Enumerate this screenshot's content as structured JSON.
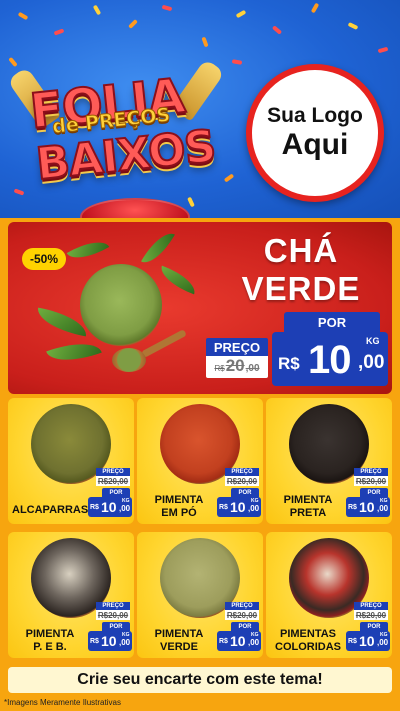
{
  "header": {
    "title_line1": "FOLIA",
    "title_line2": "de PREÇOS",
    "title_line3": "BAIXOS",
    "logo_line1": "Sua Logo",
    "logo_line2": "Aqui"
  },
  "featured": {
    "discount": "-50%",
    "title_line1": "CHÁ",
    "title_line2": "VERDE",
    "old_label": "PREÇO",
    "old_currency": "R$",
    "old_amount": "20",
    "old_cents": ",00",
    "new_label": "POR",
    "new_currency": "R$",
    "new_amount": "10",
    "new_cents": ",00",
    "unit": "KG"
  },
  "products": [
    {
      "name": "ALCAPARRAS",
      "old_label": "PREÇO",
      "old_price": "R$20,00",
      "new_label": "POR",
      "currency": "R$",
      "amount": "10",
      "cents": ",00",
      "unit": "KG"
    },
    {
      "name": "PIMENTA\nEM PÓ",
      "old_label": "PREÇO",
      "old_price": "R$20,00",
      "new_label": "POR",
      "currency": "R$",
      "amount": "10",
      "cents": ",00",
      "unit": "KG"
    },
    {
      "name": "PIMENTA\nPRETA",
      "old_label": "PREÇO",
      "old_price": "R$20,00",
      "new_label": "POR",
      "currency": "R$",
      "amount": "10",
      "cents": ",00",
      "unit": "KG"
    },
    {
      "name": "PIMENTA\nP. E B.",
      "old_label": "PREÇO",
      "old_price": "R$20,00",
      "new_label": "POR",
      "currency": "R$",
      "amount": "10",
      "cents": ",00",
      "unit": "KG"
    },
    {
      "name": "PIMENTA\nVERDE",
      "old_label": "PREÇO",
      "old_price": "R$20,00",
      "new_label": "POR",
      "currency": "R$",
      "amount": "10",
      "cents": ",00",
      "unit": "KG"
    },
    {
      "name": "PIMENTAS\nCOLORIDAS",
      "old_label": "PREÇO",
      "old_price": "R$20,00",
      "new_label": "POR",
      "currency": "R$",
      "amount": "10",
      "cents": ",00",
      "unit": "KG"
    }
  ],
  "cta": "Crie seu encarte com este tema!",
  "disclaimer": "*Imagens Meramente Ilustrativas",
  "colors": {
    "header_blue": "#1f63d4",
    "hero_red": "#c91f1b",
    "price_blue": "#1d3fb5",
    "card_yellow": "#ffd52e",
    "background_orange": "#f7a50f"
  }
}
